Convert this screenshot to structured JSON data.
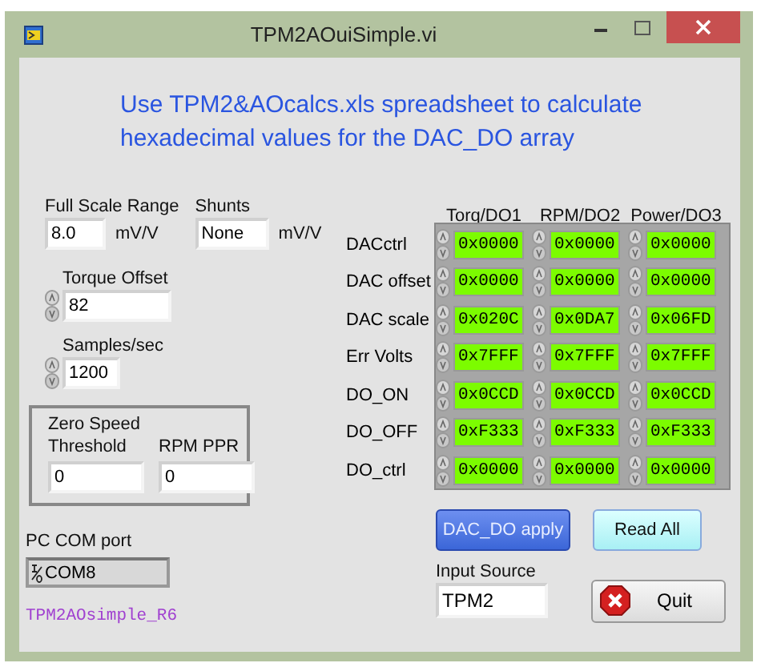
{
  "window": {
    "title": "TPM2AOuiSimple.vi"
  },
  "instruction": "Use TPM2&AOcalcs.xls spreadsheet to calculate hexadecimal values for the DAC_DO array",
  "full_scale_range": {
    "label": "Full Scale Range",
    "value": "8.0",
    "unit": "mV/V"
  },
  "shunts": {
    "label": "Shunts",
    "value": "None",
    "unit": "mV/V"
  },
  "torque_offset": {
    "label": "Torque Offset",
    "value": "82"
  },
  "samples_per_sec": {
    "label": "Samples/sec",
    "value": "1200"
  },
  "zero_speed": {
    "title": "Zero Speed",
    "fields": [
      {
        "label": "Threshold",
        "value": "0"
      },
      {
        "label": "RPM PPR",
        "value": "0"
      }
    ]
  },
  "com_port": {
    "label": "PC COM port",
    "value": "COM8"
  },
  "version": "TPM2AOsimple_R6",
  "dac_table": {
    "columns": [
      "Torq/DO1",
      "RPM/DO2",
      "Power/DO3"
    ],
    "rows": [
      {
        "label": "DACctrl",
        "values": [
          "0x0000",
          "0x0000",
          "0x0000"
        ]
      },
      {
        "label": "DAC offset",
        "values": [
          "0x0000",
          "0x0000",
          "0x0000"
        ]
      },
      {
        "label": "DAC scale",
        "values": [
          "0x020C",
          "0x0DA7",
          "0x06FD"
        ]
      },
      {
        "label": "Err Volts",
        "values": [
          "0x7FFF",
          "0x7FFF",
          "0x7FFF"
        ]
      },
      {
        "label": "DO_ON",
        "values": [
          "0x0CCD",
          "0x0CCD",
          "0x0CCD"
        ]
      },
      {
        "label": "DO_OFF",
        "values": [
          "0xF333",
          "0xF333",
          "0xF333"
        ]
      },
      {
        "label": "DO_ctrl",
        "values": [
          "0x0000",
          "0x0000",
          "0x0000"
        ]
      }
    ]
  },
  "buttons": [
    {
      "label": "DAC_DO apply",
      "kind": "primary"
    },
    {
      "label": "Read All",
      "kind": "secondary"
    }
  ],
  "input_source": {
    "label": "Input Source",
    "value": "TPM2"
  },
  "quit_button": {
    "label": "Quit"
  }
}
